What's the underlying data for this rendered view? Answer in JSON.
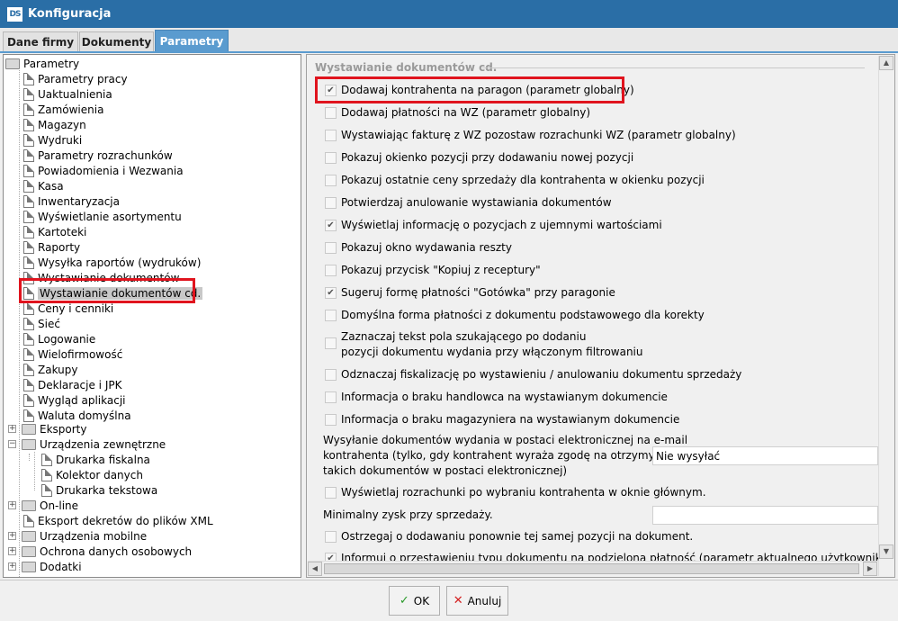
{
  "window": {
    "logo": "DS",
    "title": "Konfiguracja"
  },
  "tabs": [
    "Dane firmy",
    "Dokumenty",
    "Parametry"
  ],
  "tree": {
    "root": "Parametry",
    "items": [
      "Parametry pracy",
      "Uaktualnienia",
      "Zamówienia",
      "Magazyn",
      "Wydruki",
      "Parametry rozrachunków",
      "Powiadomienia i Wezwania",
      "Kasa",
      "Inwentaryzacja",
      "Wyświetlanie asortymentu",
      "Kartoteki",
      "Raporty",
      "Wysyłka raportów (wydruków)",
      "Wystawianie dokumentów",
      "Wystawianie dokumentów cd.",
      "Ceny i cenniki",
      "Sieć",
      "Logowanie",
      "Wielofirmowość",
      "Zakupy",
      "Deklaracje i JPK",
      "Wygląd aplikacji",
      "Waluta domyślna"
    ],
    "eksporty": "Eksporty",
    "urzadzenia": "Urządzenia zewnętrzne",
    "urzadzenia_children": [
      "Drukarka fiskalna",
      "Kolektor danych",
      "Drukarka tekstowa"
    ],
    "online": "On-line",
    "eksport_dekretow": "Eksport dekretów do plików XML",
    "mobilne": "Urządzenia mobilne",
    "ochrona": "Ochrona danych osobowych",
    "dodatki": "Dodatki"
  },
  "panel": {
    "group_title": "Wystawianie dokumentów cd.",
    "options": [
      {
        "label": "Dodawaj kontrahenta na paragon (parametr globalny)",
        "checked": true
      },
      {
        "label": "Dodawaj płatności na WZ (parametr globalny)",
        "checked": false
      },
      {
        "label": "Wystawiając fakturę z WZ pozostaw rozrachunki WZ (parametr globalny)",
        "checked": false
      },
      {
        "label": "Pokazuj okienko pozycji przy dodawaniu nowej pozycji",
        "checked": false
      },
      {
        "label": "Pokazuj ostatnie ceny sprzedaży dla kontrahenta w okienku pozycji",
        "checked": false
      },
      {
        "label": "Potwierdzaj anulowanie wystawiania dokumentów",
        "checked": false
      },
      {
        "label": "Wyświetlaj informację o pozycjach z ujemnymi wartościami",
        "checked": true
      },
      {
        "label": "Pokazuj okno wydawania reszty",
        "checked": false
      },
      {
        "label": "Pokazuj przycisk \"Kopiuj z receptury\"",
        "checked": false
      },
      {
        "label": "Sugeruj formę płatności \"Gotówka\" przy paragonie",
        "checked": true
      },
      {
        "label": "Domyślna forma płatności z dokumentu podstawowego dla korekty",
        "checked": false
      }
    ],
    "option_multiline": {
      "line1": "Zaznaczaj tekst pola szukającego po dodaniu",
      "line2": "pozycji dokumentu wydania przy włączonym filtrowaniu",
      "checked": false
    },
    "options2": [
      {
        "label": "Odznaczaj fiskalizację po wystawieniu / anulowaniu dokumentu sprzedaży",
        "checked": false
      },
      {
        "label": "Informacja o braku handlowca na wystawianym dokumencie",
        "checked": false
      },
      {
        "label": "Informacja o braku magazyniera na wystawianym dokumencie",
        "checked": false
      }
    ],
    "email_label": {
      "line1": "Wysyłanie dokumentów wydania w postaci elektronicznej na e-mail",
      "line2": "kontrahenta (tylko, gdy kontrahent wyraża zgodę na otrzymywanie",
      "line3": "takich dokumentów w postaci elektronicznej)"
    },
    "email_value": "Nie wysyłać",
    "rozrachunki": {
      "label": "Wyświetlaj rozrachunki po wybraniu kontrahenta w oknie głównym.",
      "checked": false
    },
    "min_zysk_label": "Minimalny zysk przy sprzedaży.",
    "min_zysk_value": "",
    "ostrzegaj": {
      "label": "Ostrzegaj o dodawaniu ponownie tej samej pozycji na dokument.",
      "checked": false
    },
    "informuj": {
      "label": "Informuj o przestawieniu typu dokumentu na podzieloną płatność (parametr aktualnego użytkownika)",
      "checked": true
    }
  },
  "buttons": {
    "ok": "OK",
    "cancel": "Anuluj"
  },
  "colors": {
    "titlebar": "#2a6ea6",
    "active_tab": "#5a9bcf",
    "highlight": "#e0141e"
  }
}
